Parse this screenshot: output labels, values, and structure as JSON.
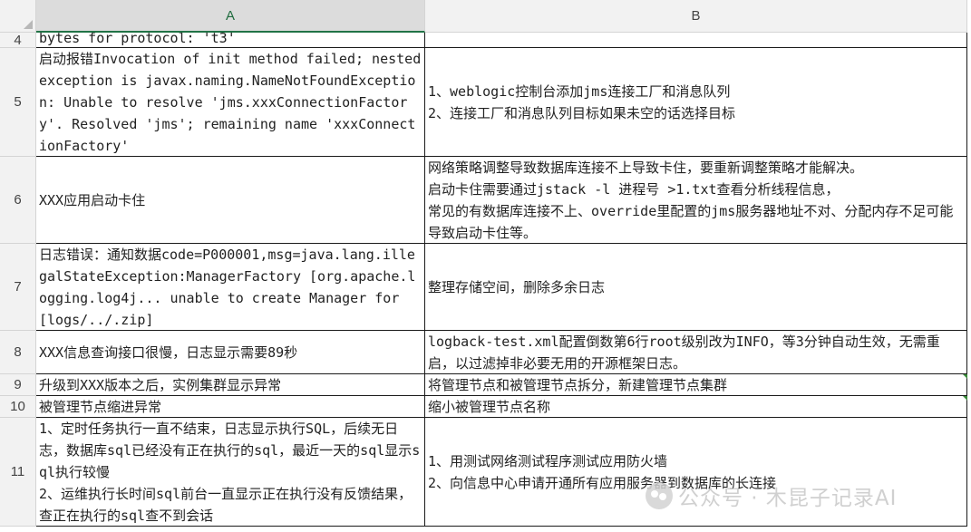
{
  "columns": {
    "a": "A",
    "b": "B"
  },
  "rows": [
    {
      "num": "4",
      "a": "bytes for protocol: 't3'",
      "b": ""
    },
    {
      "num": "5",
      "a": "启动报错Invocation of init method failed; nested exception is javax.naming.NameNotFoundException: Unable to resolve 'jms.xxxConnectionFactory'. Resolved 'jms'; remaining name 'xxxConnectionFactory'",
      "b": "1、weblogic控制台添加jms连接工厂和消息队列\n2、连接工厂和消息队列目标如果未空的话选择目标"
    },
    {
      "num": "6",
      "a": "XXX应用启动卡住",
      "b": "网络策略调整导致数据库连接不上导致卡住，要重新调整策略才能解决。\n启动卡住需要通过jstack -l 进程号 >1.txt查看分析线程信息，\n常见的有数据库连接不上、override里配置的jms服务器地址不对、分配内存不足可能导致启动卡住等。"
    },
    {
      "num": "7",
      "a": "日志错误：通知数据code=P000001,msg=java.lang.illegalStateException:ManagerFactory [org.apache.logging.log4j... unable to create Manager for [logs/../.zip]",
      "b": "整理存储空间，删除多余日志"
    },
    {
      "num": "8",
      "a": "XXX信息查询接口很慢，日志显示需要89秒",
      "b": "logback-test.xml配置倒数第6行root级别改为INFO，等3分钟自动生效，无需重启，以过滤掉非必要无用的开源框架日志。"
    },
    {
      "num": "9",
      "a": "升级到XXX版本之后，实例集群显示异常",
      "b": "将管理节点和被管理节点拆分，新建管理节点集群"
    },
    {
      "num": "10",
      "a": "被管理节点缩进异常",
      "b": "缩小被管理节点名称"
    },
    {
      "num": "11",
      "a": "1、定时任务执行一直不结束，日志显示执行SQL，后续无日志，数据库sql已经没有正在执行的sql，最近一天的sql显示sql执行较慢\n2、运维执行长时间sql前台一直显示正在执行没有反馈结果，查正在执行的sql查不到会话",
      "b": "1、用测试网络测试程序测试应用防火墙\n2、向信息中心申请开通所有应用服务器到数据库的长连接"
    }
  ],
  "watermark": "公众号 · 木昆子记录AI"
}
